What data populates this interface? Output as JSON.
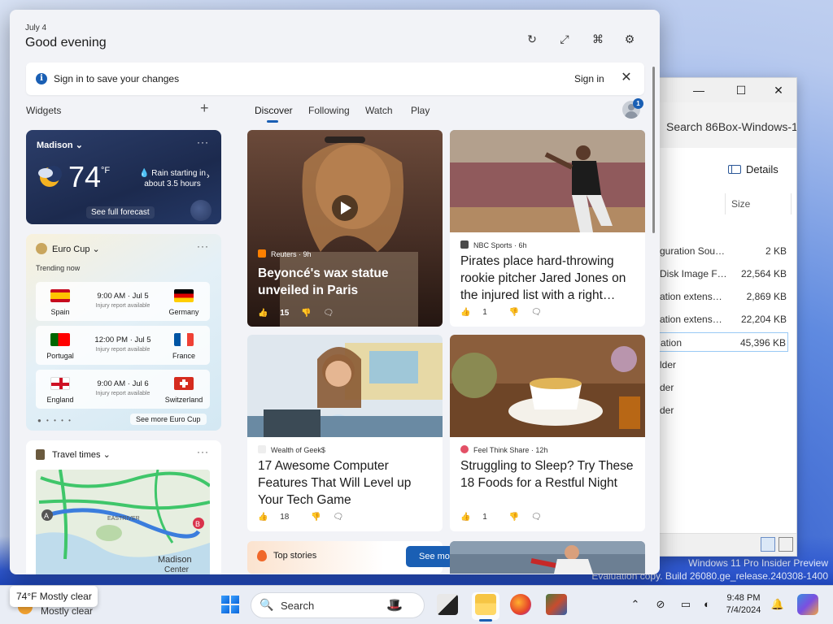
{
  "panel": {
    "date": "July 4",
    "greeting": "Good evening"
  },
  "signin": {
    "message": "Sign in to save your changes",
    "link": "Sign in"
  },
  "widgets_label": "Widgets",
  "weather": {
    "location": "Madison",
    "temperature": "74",
    "unit": "°F",
    "rain_line1": "Rain starting in",
    "rain_line2": "about 3.5 hours",
    "forecast_link": "See full forecast"
  },
  "euro": {
    "title": "Euro Cup",
    "trending": "Trending now",
    "matches": [
      {
        "home": "Spain",
        "away": "Germany",
        "time": "9:00 AM · Jul 5",
        "note": "Injury report available"
      },
      {
        "home": "Portugal",
        "away": "France",
        "time": "12:00 PM · Jul 5",
        "note": "Injury report available"
      },
      {
        "home": "England",
        "away": "Switzerland",
        "time": "9:00 AM · Jul 6",
        "note": "Injury report available"
      }
    ],
    "see_more": "See more Euro Cup"
  },
  "travel": {
    "title": "Travel times",
    "map_label_river": "EASTRIVER",
    "map_label_town": "Madison",
    "map_label_town2": "Center",
    "pin_a": "A",
    "pin_b": "B"
  },
  "tabs": [
    "Discover",
    "Following",
    "Watch",
    "Play"
  ],
  "avatar_badge": "1",
  "cards": [
    {
      "source": "Reuters · 9h",
      "headline": "Beyoncé's wax statue unveiled in Paris",
      "likes": "15"
    },
    {
      "source": "NBC Sports · 6h",
      "headline": "Pirates place hard-throwing rookie pitcher Jared Jones on the injured list with a right…",
      "likes": "1"
    },
    {
      "source": "Wealth of Geek$",
      "headline": "17 Awesome Computer Features That Will Level up Your Tech Game",
      "likes": "18"
    },
    {
      "source": "Feel Think Share · 12h",
      "headline": "Struggling to Sleep? Try These 18 Foods for a Restful Night",
      "likes": "1"
    }
  ],
  "top_stories": "Top stories",
  "see_more": "See more",
  "explorer": {
    "search": "Search 86Box-Windows-1",
    "details": "Details",
    "size_header": "Size",
    "rows": [
      {
        "name": "guration Sou…",
        "size": "2 KB"
      },
      {
        "name": "Disk Image F…",
        "size": "22,564 KB"
      },
      {
        "name": "ation extens…",
        "size": "2,869 KB"
      },
      {
        "name": "ation extens…",
        "size": "22,204 KB"
      },
      {
        "name": "ation",
        "size": "45,396 KB"
      },
      {
        "name": "lder",
        "size": ""
      },
      {
        "name": "der",
        "size": ""
      },
      {
        "name": "der",
        "size": ""
      }
    ]
  },
  "watermark": {
    "line1": "Windows 11 Pro Insider Preview",
    "line2": "Evaluation copy. Build 26080.ge_release.240308-1400"
  },
  "taskbar": {
    "weather_popup": "74°F Mostly clear",
    "weather_sub": "Mostly clear",
    "search": "Search",
    "time": "9:48 PM",
    "date": "7/4/2024"
  }
}
